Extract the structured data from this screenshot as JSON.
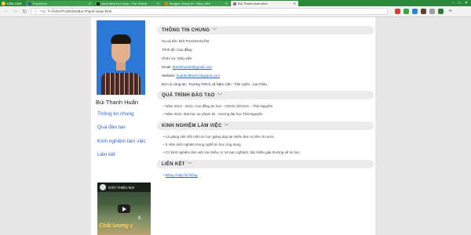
{
  "browser": {
    "brand": "CỐC CỐC",
    "tabs": [
      {
        "label": "Facebook",
        "icon_color": "#3b5998",
        "active": false
      },
      {
        "label": "Speedtest by Ookla - The Global",
        "icon_color": "#1e1e1e",
        "active": false
      },
      {
        "label": "Blogger: Bảng tin - Bảng điều",
        "icon_color": "#f57d00",
        "active": false
      },
      {
        "label": "Bùi Thanh Huấn.html",
        "icon_color": "#7a7a7a",
        "active": true
      }
    ],
    "url_protocol": "Tệp",
    "url": "F:/ẢnhHT%20HSo/Bui-Thanh-Huan.html",
    "window_controls": {
      "minimize": "–",
      "maximize": "□",
      "close": "✕"
    }
  },
  "profile": {
    "name": "Bùi Thanh Huấn"
  },
  "sidebar_links": [
    {
      "label": "Thông tin chung"
    },
    {
      "label": "Quá đào tạo"
    },
    {
      "label": "Kinh nghiệm làm việc"
    },
    {
      "label": "Liên kết"
    }
  ],
  "video": {
    "header": "GIỚI THIỆU ĐẠI",
    "overlay_top": "K",
    "overlay_title": "Chất lượng c"
  },
  "sections": {
    "general": {
      "title": "THÔNG TIN CHUNG",
      "rows": [
        {
          "key": "Họ và tên: ",
          "value": "BÙI THANH HUẤN",
          "link": false
        },
        {
          "key": "Trình độ: ",
          "value": "Cao đẳng",
          "link": false
        },
        {
          "key": "Chức vụ: ",
          "value": "Giáo viên",
          "link": false
        },
        {
          "key": "Email: ",
          "value": "thanhhuanbt@gmail.com",
          "link": true
        },
        {
          "key": "Website: ",
          "value": "huanbuithanh.blogspot.com",
          "link": true
        },
        {
          "key": "Đơn vị công tác: ",
          "value": "Trường THCS xã Nậm Cần - Tân Uyên - Lai Châu",
          "link": false
        }
      ]
    },
    "education": {
      "title": "QUÁ TRÌNH ĐÀO TẠO",
      "items": [
        "Năm 2013 - 2014: Cao đẳng tin học - CĐCN Việt Đức - Thái Nguyên",
        "Năm 2021: Đại học sư phạm tin - trường đại học Thái Nguyên"
      ]
    },
    "experience": {
      "title": "KINH NGHIỆM LÀM VIỆC",
      "items": [
        "Là giảng viên bồi mồn tin học giảng dạy tại nhiều đơn vị trên cả nước.",
        "5 năm kinh nghiệm trong nghề tin học ứng dụng",
        "Có kinh nghiệm làm việc tại nhiều cơ sở ban nghành, đạt nhiều giải thưởng về tin học"
      ]
    },
    "links": {
      "title": "LIÊN KẾT",
      "items": [
        "Đăng nhập hệ thống"
      ]
    }
  }
}
